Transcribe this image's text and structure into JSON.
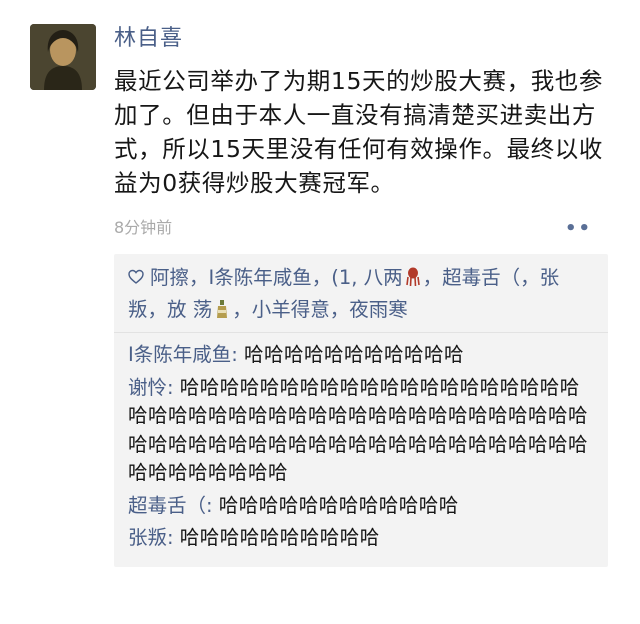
{
  "post": {
    "author": "林自喜",
    "text": "最近公司举办了为期15天的炒股大赛，我也参加了。但由于本人一直没有搞清楚买进卖出方式，所以15天里没有任何有效操作。最终以收益为0获得炒股大赛冠军。",
    "timestamp": "8分钟前",
    "more_label": "••"
  },
  "likes": {
    "part1": "阿擦，I条陈年咸鱼，(1, 八两",
    "part2": "，超毒舌（，张叛，放 荡",
    "part3": "，小羊得意，夜雨寒"
  },
  "comments": [
    {
      "name": "I条陈年咸鱼",
      "text": "哈哈哈哈哈哈哈哈哈哈哈"
    },
    {
      "name": "谢怜",
      "text": "哈哈哈哈哈哈哈哈哈哈哈哈哈哈哈哈哈哈哈哈哈哈哈哈哈哈哈哈哈哈哈哈哈哈哈哈哈哈哈哈哈哈哈哈哈哈哈哈哈哈哈哈哈哈哈哈哈哈哈哈哈哈哈哈哈哈哈哈哈哈哈哈哈哈"
    },
    {
      "name": "超毒舌（",
      "text": "哈哈哈哈哈哈哈哈哈哈哈哈"
    },
    {
      "name": "张叛",
      "text": "哈哈哈哈哈哈哈哈哈哈"
    }
  ],
  "icons": {
    "like": "heart-outline-icon",
    "emoji1": "squid-emoji-icon",
    "emoji2": "bottle-emoji-icon"
  },
  "colors": {
    "name_blue": "#4a5f88",
    "panel_bg": "#f3f3f3",
    "timestamp_gray": "#aaaaaa"
  }
}
